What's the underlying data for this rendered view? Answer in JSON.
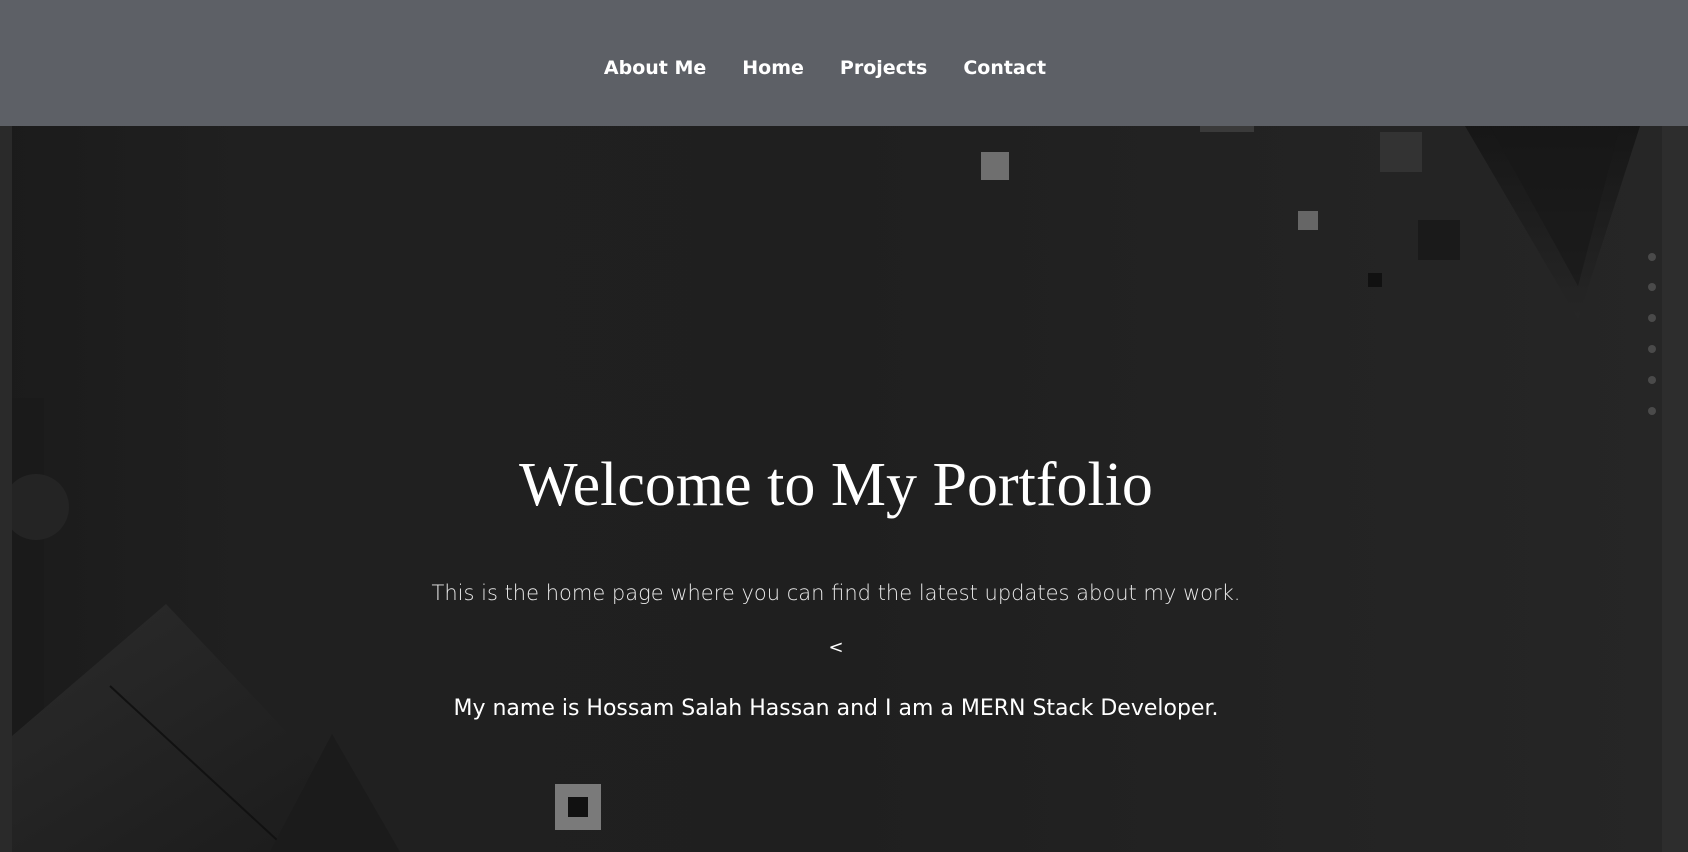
{
  "nav": {
    "items": [
      {
        "label": "About Me"
      },
      {
        "label": "Home"
      },
      {
        "label": "Projects"
      },
      {
        "label": "Contact"
      }
    ]
  },
  "hero": {
    "title": "Welcome to My Portfolio",
    "subtitle": "This is the home page where you can find the latest updates about my work.",
    "symbol": "<",
    "intro": "My name is Hossam Salah Hassan and I am a MERN Stack Developer."
  },
  "colors": {
    "navbar_bg": "#5d6066",
    "page_bg": "#1f1f1f",
    "text": "#ffffff"
  }
}
